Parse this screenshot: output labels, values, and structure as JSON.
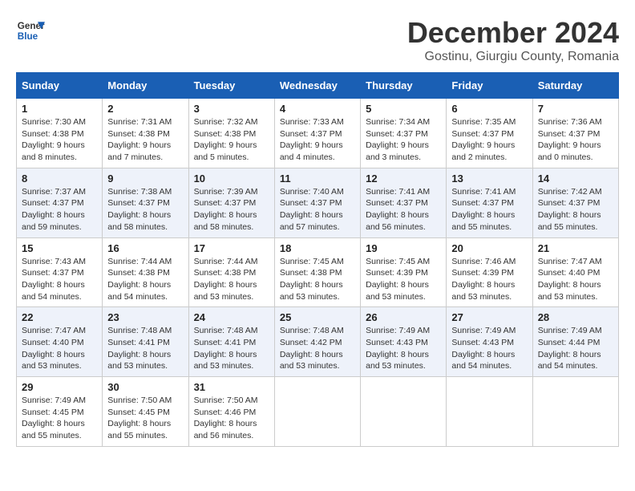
{
  "header": {
    "logo_line1": "General",
    "logo_line2": "Blue",
    "month_year": "December 2024",
    "location": "Gostinu, Giurgiu County, Romania"
  },
  "days_of_week": [
    "Sunday",
    "Monday",
    "Tuesday",
    "Wednesday",
    "Thursday",
    "Friday",
    "Saturday"
  ],
  "weeks": [
    [
      {
        "day": "1",
        "sunrise": "7:30 AM",
        "sunset": "4:38 PM",
        "daylight": "9 hours and 8 minutes."
      },
      {
        "day": "2",
        "sunrise": "7:31 AM",
        "sunset": "4:38 PM",
        "daylight": "9 hours and 7 minutes."
      },
      {
        "day": "3",
        "sunrise": "7:32 AM",
        "sunset": "4:38 PM",
        "daylight": "9 hours and 5 minutes."
      },
      {
        "day": "4",
        "sunrise": "7:33 AM",
        "sunset": "4:37 PM",
        "daylight": "9 hours and 4 minutes."
      },
      {
        "day": "5",
        "sunrise": "7:34 AM",
        "sunset": "4:37 PM",
        "daylight": "9 hours and 3 minutes."
      },
      {
        "day": "6",
        "sunrise": "7:35 AM",
        "sunset": "4:37 PM",
        "daylight": "9 hours and 2 minutes."
      },
      {
        "day": "7",
        "sunrise": "7:36 AM",
        "sunset": "4:37 PM",
        "daylight": "9 hours and 0 minutes."
      }
    ],
    [
      {
        "day": "8",
        "sunrise": "7:37 AM",
        "sunset": "4:37 PM",
        "daylight": "8 hours and 59 minutes."
      },
      {
        "day": "9",
        "sunrise": "7:38 AM",
        "sunset": "4:37 PM",
        "daylight": "8 hours and 58 minutes."
      },
      {
        "day": "10",
        "sunrise": "7:39 AM",
        "sunset": "4:37 PM",
        "daylight": "8 hours and 58 minutes."
      },
      {
        "day": "11",
        "sunrise": "7:40 AM",
        "sunset": "4:37 PM",
        "daylight": "8 hours and 57 minutes."
      },
      {
        "day": "12",
        "sunrise": "7:41 AM",
        "sunset": "4:37 PM",
        "daylight": "8 hours and 56 minutes."
      },
      {
        "day": "13",
        "sunrise": "7:41 AM",
        "sunset": "4:37 PM",
        "daylight": "8 hours and 55 minutes."
      },
      {
        "day": "14",
        "sunrise": "7:42 AM",
        "sunset": "4:37 PM",
        "daylight": "8 hours and 55 minutes."
      }
    ],
    [
      {
        "day": "15",
        "sunrise": "7:43 AM",
        "sunset": "4:37 PM",
        "daylight": "8 hours and 54 minutes."
      },
      {
        "day": "16",
        "sunrise": "7:44 AM",
        "sunset": "4:38 PM",
        "daylight": "8 hours and 54 minutes."
      },
      {
        "day": "17",
        "sunrise": "7:44 AM",
        "sunset": "4:38 PM",
        "daylight": "8 hours and 53 minutes."
      },
      {
        "day": "18",
        "sunrise": "7:45 AM",
        "sunset": "4:38 PM",
        "daylight": "8 hours and 53 minutes."
      },
      {
        "day": "19",
        "sunrise": "7:45 AM",
        "sunset": "4:39 PM",
        "daylight": "8 hours and 53 minutes."
      },
      {
        "day": "20",
        "sunrise": "7:46 AM",
        "sunset": "4:39 PM",
        "daylight": "8 hours and 53 minutes."
      },
      {
        "day": "21",
        "sunrise": "7:47 AM",
        "sunset": "4:40 PM",
        "daylight": "8 hours and 53 minutes."
      }
    ],
    [
      {
        "day": "22",
        "sunrise": "7:47 AM",
        "sunset": "4:40 PM",
        "daylight": "8 hours and 53 minutes."
      },
      {
        "day": "23",
        "sunrise": "7:48 AM",
        "sunset": "4:41 PM",
        "daylight": "8 hours and 53 minutes."
      },
      {
        "day": "24",
        "sunrise": "7:48 AM",
        "sunset": "4:41 PM",
        "daylight": "8 hours and 53 minutes."
      },
      {
        "day": "25",
        "sunrise": "7:48 AM",
        "sunset": "4:42 PM",
        "daylight": "8 hours and 53 minutes."
      },
      {
        "day": "26",
        "sunrise": "7:49 AM",
        "sunset": "4:43 PM",
        "daylight": "8 hours and 53 minutes."
      },
      {
        "day": "27",
        "sunrise": "7:49 AM",
        "sunset": "4:43 PM",
        "daylight": "8 hours and 54 minutes."
      },
      {
        "day": "28",
        "sunrise": "7:49 AM",
        "sunset": "4:44 PM",
        "daylight": "8 hours and 54 minutes."
      }
    ],
    [
      {
        "day": "29",
        "sunrise": "7:49 AM",
        "sunset": "4:45 PM",
        "daylight": "8 hours and 55 minutes."
      },
      {
        "day": "30",
        "sunrise": "7:50 AM",
        "sunset": "4:45 PM",
        "daylight": "8 hours and 55 minutes."
      },
      {
        "day": "31",
        "sunrise": "7:50 AM",
        "sunset": "4:46 PM",
        "daylight": "8 hours and 56 minutes."
      },
      null,
      null,
      null,
      null
    ]
  ],
  "labels": {
    "sunrise": "Sunrise:",
    "sunset": "Sunset:",
    "daylight": "Daylight:"
  }
}
